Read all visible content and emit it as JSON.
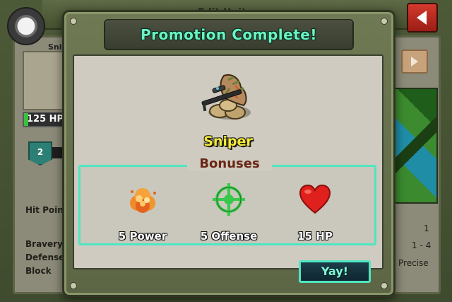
{
  "background": {
    "title": "Edit Unit",
    "unit_name": "Sniper",
    "hp_badge": "125 HP",
    "level": "2",
    "stats": [
      {
        "label": "Hit Points"
      },
      {
        "label": "Bravery"
      },
      {
        "label": "Defense"
      },
      {
        "label": "Block"
      }
    ],
    "right_values": [
      "1",
      "1 - 4",
      "Precise"
    ]
  },
  "dialog": {
    "title": "Promotion Complete!",
    "unit_name": "Sniper",
    "bonuses_heading": "Bonuses",
    "bonuses": [
      {
        "icon": "explosion-icon",
        "label": "5 Power"
      },
      {
        "icon": "crosshair-icon",
        "label": "5 Offense"
      },
      {
        "icon": "heart-icon",
        "label": "15 HP"
      }
    ],
    "confirm_label": "Yay!"
  },
  "colors": {
    "title_text": "#67f5c2",
    "accent_teal": "#4fe6c2",
    "unit_name": "#f3e93b",
    "bonuses_heading": "#6a2715",
    "heart": "#e0201c",
    "crosshair": "#39c94a",
    "back_button": "#c62f22"
  }
}
